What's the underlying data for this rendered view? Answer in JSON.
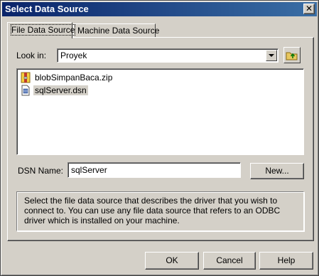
{
  "window": {
    "title": "Select Data Source",
    "close_label": "✕"
  },
  "tabs": [
    {
      "label": "File Data Source",
      "active": true
    },
    {
      "label": "Machine Data Source",
      "active": false
    }
  ],
  "look_in": {
    "label": "Look in:",
    "value": "Proyek"
  },
  "files": [
    {
      "name": "blobSimpanBaca.zip",
      "icon": "zip-file-icon",
      "selected": false
    },
    {
      "name": "sqlServer.dsn",
      "icon": "dsn-file-icon",
      "selected": true
    }
  ],
  "dsn": {
    "label": "DSN Name:",
    "value": "sqlServer",
    "new_button": "New..."
  },
  "description": "Select the file data source that describes the driver that you wish to connect to. You can use any file data source that refers to an ODBC driver which is installed on your machine.",
  "buttons": {
    "ok": "OK",
    "cancel": "Cancel",
    "help": "Help"
  }
}
